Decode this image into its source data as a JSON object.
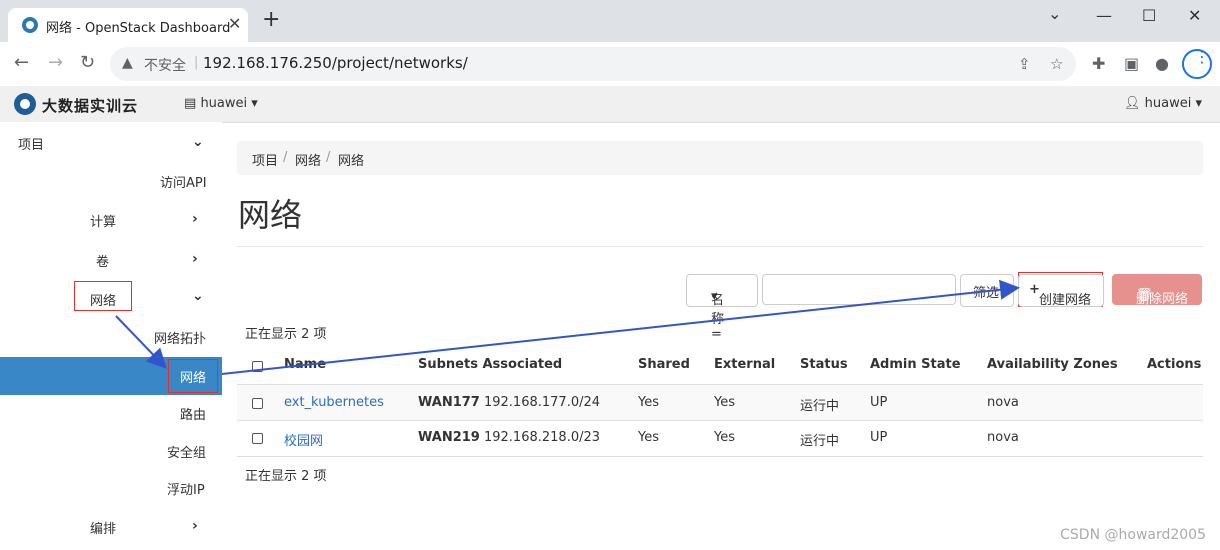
{
  "browser": {
    "tab_title": "网络 - OpenStack Dashboard",
    "tab_close": "✕",
    "new_tab": "+",
    "minimize": "—",
    "maximize": "☐",
    "close": "✕",
    "insecure_label": "不安全",
    "url": "192.168.176.250/project/networks/"
  },
  "app": {
    "logo_text": "大数据实训云",
    "project_selector": "huawei",
    "user_menu": "huawei"
  },
  "sidebar": {
    "project": "项目",
    "access_api": "访问API",
    "compute": "计算",
    "volumes": "卷",
    "network": "网络",
    "network_topology": "网络拓扑",
    "networks": "网络",
    "routers": "路由",
    "security_groups": "安全组",
    "floating_ips": "浮动IP",
    "orchestration": "编排"
  },
  "breadcrumb": [
    "项目",
    "网络",
    "网络"
  ],
  "page_title": "网络",
  "filter": {
    "field": "名称 =",
    "input_value": "",
    "filter_button": "筛选"
  },
  "actions": {
    "create": "创建网络",
    "delete": "删除网络"
  },
  "count_text": "正在显示 2 项",
  "table": {
    "headers": [
      "Name",
      "Subnets Associated",
      "Shared",
      "External",
      "Status",
      "Admin State",
      "Availability Zones",
      "Actions"
    ],
    "rows": [
      {
        "name": "ext_kubernetes",
        "subnet_name": "WAN177",
        "subnet_cidr": "192.168.177.0/24",
        "shared": "Yes",
        "external": "Yes",
        "status": "运行中",
        "admin_state": "UP",
        "zones": "nova"
      },
      {
        "name": "校园网",
        "subnet_name": "WAN219",
        "subnet_cidr": "192.168.218.0/23",
        "shared": "Yes",
        "external": "Yes",
        "status": "运行中",
        "admin_state": "UP",
        "zones": "nova"
      }
    ]
  },
  "watermark": "CSDN @howard2005",
  "colors": {
    "active_nav": "#3a87c8",
    "annotation_red": "#e03030",
    "annotation_arrow": "#3355cc",
    "link": "#2a6ebb",
    "delete_button": "#e6918e"
  }
}
